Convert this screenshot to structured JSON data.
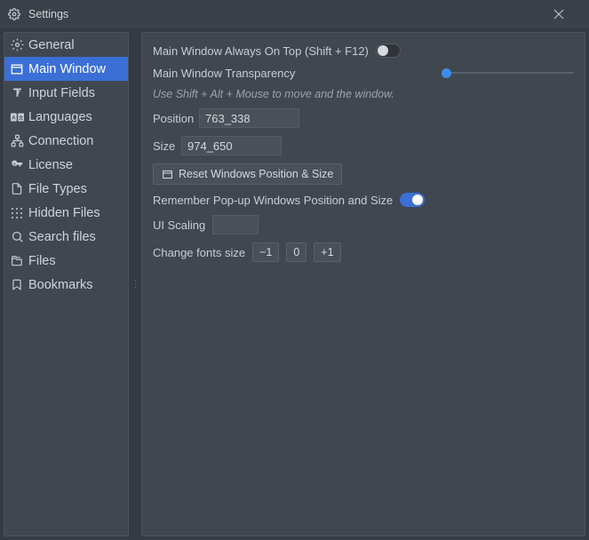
{
  "window": {
    "title": "Settings"
  },
  "sidebar": {
    "items": [
      {
        "label": "General"
      },
      {
        "label": "Main Window"
      },
      {
        "label": "Input Fields"
      },
      {
        "label": "Languages"
      },
      {
        "label": "Connection"
      },
      {
        "label": "License"
      },
      {
        "label": "File Types"
      },
      {
        "label": "Hidden Files"
      },
      {
        "label": "Search files"
      },
      {
        "label": "Files"
      },
      {
        "label": "Bookmarks"
      }
    ]
  },
  "main": {
    "always_on_top_label": "Main Window Always On Top (Shift + F12)",
    "always_on_top": false,
    "transparency_label": "Main Window Transparency",
    "move_hint": "Use Shift + Alt + Mouse to move and the window.",
    "position_label": "Position",
    "position_value": "763_338",
    "size_label": "Size",
    "size_value": "974_650",
    "reset_label": "Reset Windows Position & Size",
    "remember_label": "Remember Pop-up Windows Position and Size",
    "remember": true,
    "ui_scaling_label": "UI Scaling",
    "ui_scaling_value": "",
    "fonts_label": "Change fonts size",
    "font_minus": "−1",
    "font_zero": "0",
    "font_plus": "+1"
  }
}
